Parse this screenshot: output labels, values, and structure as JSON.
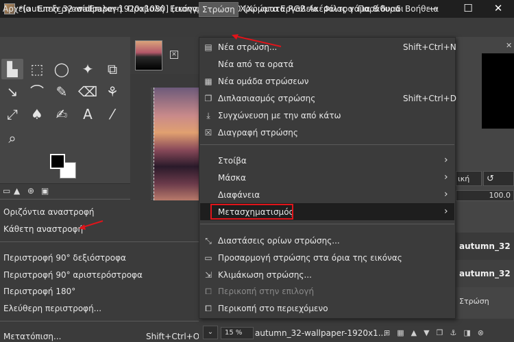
{
  "window": {
    "title": "*[autumn_32-wallpaper-1920x1080] (εισηγμένη)-27.0 (Χρώματα RGB Ακέραιος γάμα 8 δυαδικών, GIMP built...",
    "minimize": "—",
    "maximize": "☐",
    "close": "✕"
  },
  "menubar": {
    "items": [
      "Αρχείο",
      "Επεξεργασία",
      "Επιλογή",
      "Προβολή",
      "Εικόνα",
      "Στρώση",
      "Χρώματα",
      "Εργαλεία",
      "Φίλτρα",
      "Παράθυρα",
      "Βοήθεια"
    ],
    "active": "Στρώση"
  },
  "toolbox": {
    "tools": [
      "▙",
      "⬚",
      "◯",
      "✦",
      "⧉",
      "↘",
      "⌒",
      "✎",
      "⌫",
      "⚘",
      "⤢",
      "♠",
      "✍",
      "A",
      "⁄",
      "⌕"
    ],
    "dock_tabs": [
      "▭",
      "▲",
      "⊕",
      "▣"
    ]
  },
  "image_tab": {
    "close": "✕"
  },
  "layer_menu": {
    "items": [
      {
        "icon": "▤",
        "label": "Νέα στρώση...",
        "shortcut": "Shift+Ctrl+N"
      },
      {
        "icon": "",
        "label": "Νέα από τα ορατά",
        "shortcut": ""
      },
      {
        "icon": "▦",
        "label": "Νέα ομάδα στρώσεων",
        "shortcut": ""
      },
      {
        "icon": "❐",
        "label": "Διπλασιασμός στρώσης",
        "shortcut": "Shift+Ctrl+D"
      },
      {
        "icon": "⤓",
        "label": "Συγχώνευση με την από κάτω",
        "shortcut": ""
      },
      {
        "icon": "☒",
        "label": "Διαγραφή στρώσης",
        "shortcut": ""
      },
      {
        "icon": "",
        "label": "Στοίβα",
        "shortcut": ""
      },
      {
        "icon": "",
        "label": "Μάσκα",
        "shortcut": ""
      },
      {
        "icon": "",
        "label": "Διαφάνεια",
        "shortcut": ""
      },
      {
        "icon": "",
        "label": "Μετασχηματισμός",
        "shortcut": ""
      },
      {
        "icon": "⤡",
        "label": "Διαστάσεις ορίων στρώσης...",
        "shortcut": ""
      },
      {
        "icon": "▭",
        "label": "Προσαρμογή στρώσης στα όρια της εικόνας",
        "shortcut": ""
      },
      {
        "icon": "⇲",
        "label": "Κλιμάκωση στρώσης...",
        "shortcut": ""
      },
      {
        "icon": "⧠",
        "label": "Περικοπή στην επιλογή",
        "shortcut": ""
      },
      {
        "icon": "⧠",
        "label": "Περικοπή στο περιεχόμενο",
        "shortcut": ""
      }
    ],
    "submenu_arrow": "›"
  },
  "transform_menu": {
    "items": [
      {
        "label": "Οριζόντια αναστροφή",
        "shortcut": ""
      },
      {
        "label": "Κάθετη αναστροφή",
        "shortcut": ""
      },
      {
        "label": "Περιστροφή 90° δεξιόστροφα",
        "shortcut": ""
      },
      {
        "label": "Περιστροφή 90° αριστερόστροφα",
        "shortcut": ""
      },
      {
        "label": "Περιστροφή 180°",
        "shortcut": ""
      },
      {
        "label": "Ελεύθερη περιστροφή...",
        "shortcut": ""
      },
      {
        "label": "Μετατόπιση...",
        "shortcut": "Shift+Ctrl+O"
      }
    ]
  },
  "right_dock": {
    "mode_partial": "ική",
    "undo_icon": "↺",
    "opacity": "100.0",
    "layers": [
      {
        "name": "autumn_32"
      },
      {
        "name": "autumn_32"
      }
    ],
    "layer_label": "Στρώση",
    "close": "✕"
  },
  "statusbar": {
    "zoom": "15 %",
    "text": "autumn_32-wallpaper-1920x1..."
  },
  "accent_colors": {
    "highlight_box": "#e0141a",
    "arrow": "#e0141a"
  }
}
